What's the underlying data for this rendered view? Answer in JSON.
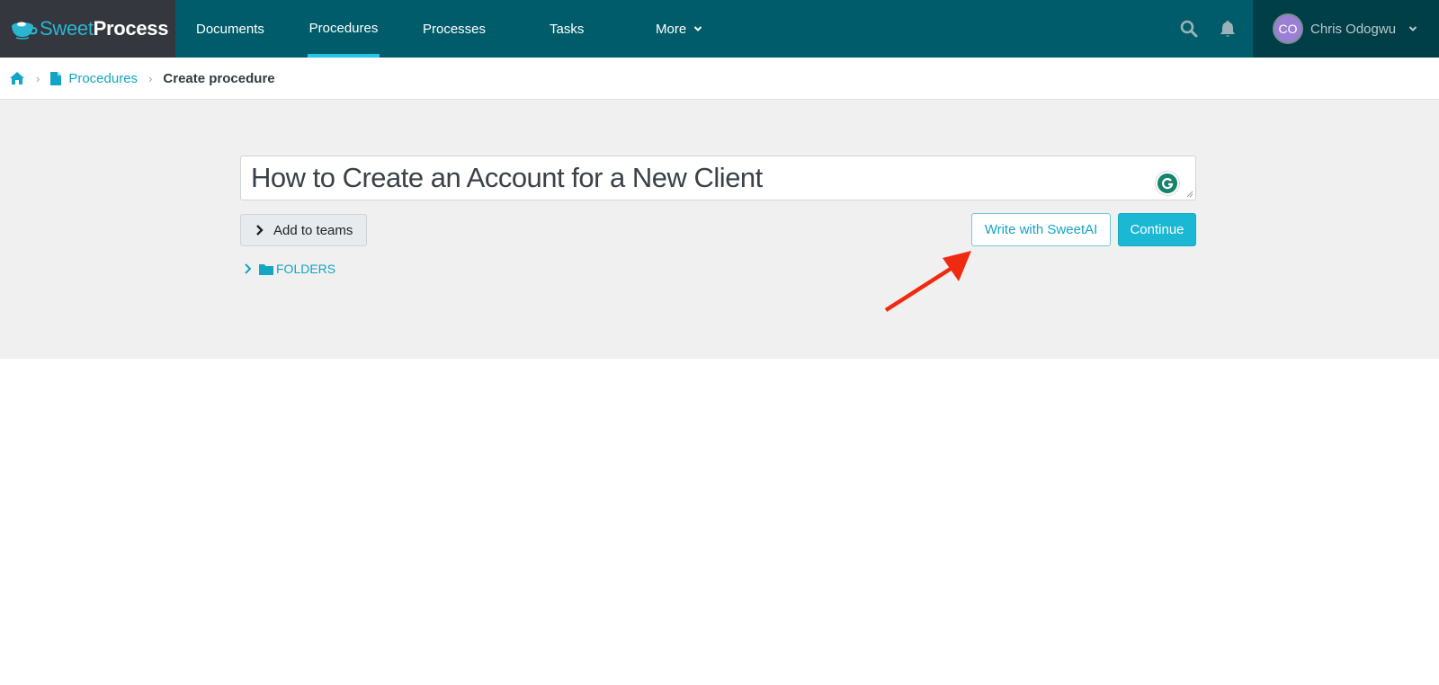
{
  "app": {
    "brand_sweet": "Sweet",
    "brand_process": "Process"
  },
  "nav": {
    "items": [
      {
        "label": "Documents",
        "active": false
      },
      {
        "label": "Procedures",
        "active": true
      },
      {
        "label": "Processes",
        "active": false
      },
      {
        "label": "Tasks",
        "active": false
      },
      {
        "label": "More",
        "active": false,
        "has_dropdown": true
      }
    ],
    "icons": [
      "search-icon",
      "bell-icon"
    ],
    "user": {
      "initials": "CO",
      "name": "Chris Odogwu",
      "avatar_color": "#9b7fd4"
    }
  },
  "breadcrumb": {
    "home_icon": "home-icon",
    "items": [
      {
        "label": "Procedures",
        "icon": "document-icon",
        "link": true
      },
      {
        "label": "Create procedure",
        "link": false
      }
    ]
  },
  "form": {
    "title_value": "How to Create an Account for a New Client",
    "add_to_teams_label": "Add to teams",
    "folders_label": "FOLDERS",
    "write_with_ai_label": "Write with SweetAI",
    "continue_label": "Continue"
  },
  "colors": {
    "nav_bg": "#005c6a",
    "brand_bg": "#34373e",
    "user_bg": "#003e48",
    "accent": "#1ab8d2",
    "link": "#13a5c4",
    "annotation_arrow": "#f02a10"
  }
}
